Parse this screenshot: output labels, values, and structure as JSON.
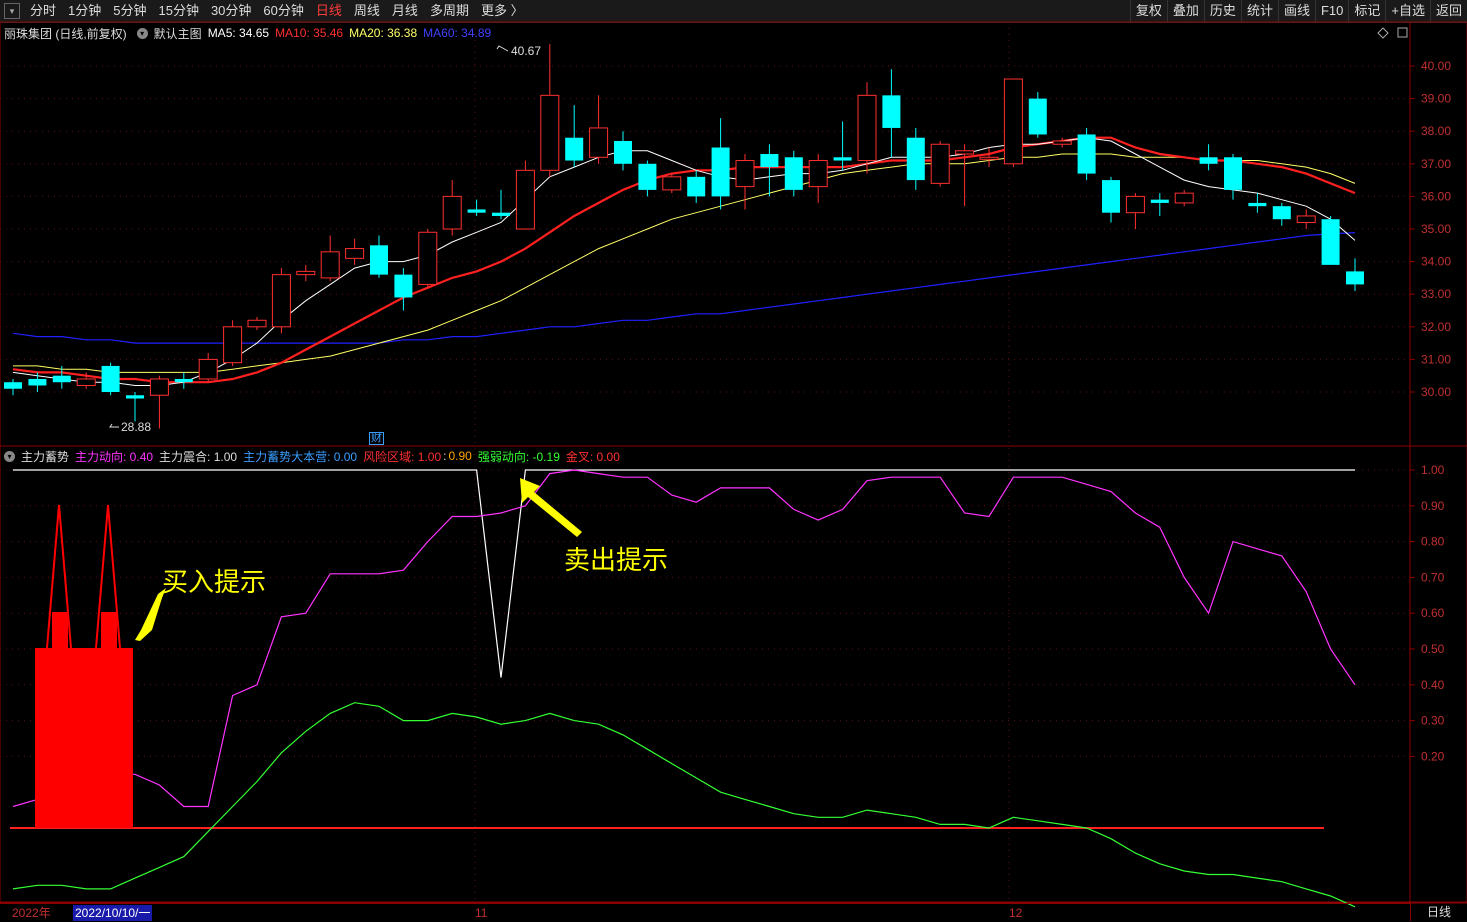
{
  "toolbar": {
    "periods": [
      "分时",
      "1分钟",
      "5分钟",
      "15分钟",
      "30分钟",
      "60分钟",
      "日线",
      "周线",
      "月线",
      "多周期",
      "更多 〉"
    ],
    "active_period": "日线",
    "right_buttons": [
      "复权",
      "叠加",
      "历史",
      "统计",
      "画线",
      "F10",
      "标记",
      "+自选",
      "返回"
    ]
  },
  "main_legend": {
    "stock": "丽珠集团 (日线,前复权)",
    "template": "默认主图",
    "ma5": "MA5: 34.65",
    "ma10": "MA10: 35.46",
    "ma20": "MA20: 36.38",
    "ma60": "MA60: 34.89"
  },
  "sub_legend": {
    "name": "主力蓄势",
    "dir": "主力动向: 0.40",
    "coin": "主力震合: 1.00",
    "big": "主力蓄势大本营: 0.00",
    "risk_label": "风险区域: 1.00",
    "risk_sep": ":",
    "risk_val": "0.90",
    "strong": "强弱动向: -0.19",
    "gold": "金叉: 0.00"
  },
  "colors": {
    "up": "#ff3030",
    "down": "#00ffff",
    "ma5": "#ffffff",
    "ma10": "#ff2020",
    "ma20": "#ffff66",
    "ma60": "#2020ff",
    "dir": "#ff33ff",
    "strong": "#33ff33",
    "annot": "#ffff00"
  },
  "price_axis": [
    "40.00",
    "39.00",
    "38.00",
    "37.00",
    "36.00",
    "35.00",
    "34.00",
    "33.00",
    "32.00",
    "31.00",
    "30.00"
  ],
  "ind_axis": [
    "1.00",
    "0.90",
    "0.80",
    "0.70",
    "0.60",
    "0.50",
    "0.40",
    "0.30",
    "0.20"
  ],
  "marks": {
    "high": "40.67",
    "low": "28.88",
    "cai": "财"
  },
  "dates": {
    "year": "2022年",
    "cursor": "2022/10/10/一",
    "m11": "11",
    "m12": "12"
  },
  "annotations": {
    "buy": "买入提示",
    "sell": "卖出提示"
  },
  "corner": "日线",
  "candles": [
    [
      30.3,
      30.1,
      30.4,
      29.9
    ],
    [
      30.4,
      30.2,
      30.6,
      30.0
    ],
    [
      30.5,
      30.3,
      30.8,
      30.1
    ],
    [
      30.2,
      30.4,
      30.6,
      30.1
    ],
    [
      30.8,
      30.0,
      30.9,
      29.9
    ],
    [
      29.9,
      29.8,
      30.0,
      29.1
    ],
    [
      29.9,
      30.4,
      30.5,
      28.88
    ],
    [
      30.4,
      30.3,
      30.6,
      30.1
    ],
    [
      30.4,
      31.0,
      31.2,
      30.3
    ],
    [
      30.9,
      32.0,
      32.2,
      30.8
    ],
    [
      32.0,
      32.2,
      32.3,
      31.9
    ],
    [
      32.0,
      33.6,
      33.8,
      31.8
    ],
    [
      33.6,
      33.7,
      33.9,
      33.4
    ],
    [
      33.5,
      34.3,
      34.8,
      33.4
    ],
    [
      34.1,
      34.4,
      34.7,
      33.9
    ],
    [
      34.5,
      33.6,
      34.8,
      33.5
    ],
    [
      33.6,
      32.9,
      33.8,
      32.5
    ],
    [
      33.3,
      34.9,
      35.0,
      33.2
    ],
    [
      35.0,
      36.0,
      36.5,
      34.8
    ],
    [
      35.6,
      35.5,
      35.9,
      35.4
    ],
    [
      35.5,
      35.4,
      36.2,
      35.3
    ],
    [
      35.0,
      36.8,
      37.1,
      35.0
    ],
    [
      36.8,
      39.1,
      40.67,
      36.6
    ],
    [
      37.8,
      37.1,
      38.8,
      36.9
    ],
    [
      37.2,
      38.1,
      39.1,
      37.0
    ],
    [
      37.7,
      37.0,
      38.0,
      36.8
    ],
    [
      37.0,
      36.2,
      37.1,
      36.0
    ],
    [
      36.2,
      36.6,
      36.7,
      36.1
    ],
    [
      36.6,
      36.0,
      36.8,
      35.8
    ],
    [
      37.5,
      36.0,
      38.4,
      35.6
    ],
    [
      36.3,
      37.1,
      37.3,
      35.6
    ],
    [
      37.3,
      36.9,
      37.6,
      36.0
    ],
    [
      37.2,
      36.2,
      37.4,
      36.0
    ],
    [
      36.3,
      37.1,
      37.3,
      35.8
    ],
    [
      37.2,
      37.1,
      38.3,
      36.8
    ],
    [
      37.1,
      39.1,
      39.5,
      36.7
    ],
    [
      39.1,
      38.1,
      39.9,
      37.2
    ],
    [
      37.8,
      36.5,
      38.1,
      36.2
    ],
    [
      36.4,
      37.6,
      37.7,
      36.3
    ],
    [
      37.3,
      37.4,
      37.6,
      35.7
    ],
    [
      37.2,
      37.2,
      37.5,
      36.9
    ],
    [
      37.0,
      39.6,
      39.6,
      36.9
    ],
    [
      39.0,
      37.9,
      39.2,
      37.8
    ],
    [
      37.6,
      37.7,
      37.8,
      37.5
    ],
    [
      37.9,
      36.7,
      38.1,
      36.5
    ],
    [
      36.5,
      35.5,
      36.6,
      35.2
    ],
    [
      35.5,
      36.0,
      36.1,
      35.0
    ],
    [
      35.9,
      35.8,
      36.1,
      35.4
    ],
    [
      35.8,
      36.1,
      36.2,
      35.7
    ],
    [
      37.2,
      37.0,
      37.6,
      36.8
    ],
    [
      37.2,
      36.2,
      37.3,
      35.9
    ],
    [
      35.8,
      35.7,
      36.1,
      35.5
    ],
    [
      35.7,
      35.3,
      35.8,
      35.1
    ],
    [
      35.2,
      35.4,
      35.6,
      35.0
    ],
    [
      35.3,
      33.9,
      35.4,
      33.9
    ],
    [
      33.7,
      33.3,
      34.1,
      33.1
    ]
  ],
  "ma5": [
    30.6,
    30.5,
    30.4,
    30.3,
    30.3,
    30.2,
    30.2,
    30.3,
    30.6,
    31.0,
    31.5,
    32.2,
    32.8,
    33.3,
    33.8,
    34.0,
    34.0,
    34.2,
    34.6,
    34.9,
    35.2,
    35.9,
    36.6,
    36.9,
    37.2,
    37.4,
    37.4,
    37.1,
    36.8,
    36.6,
    36.5,
    36.6,
    36.7,
    36.7,
    36.8,
    37.0,
    37.2,
    37.2,
    37.2,
    37.3,
    37.5,
    37.6,
    37.6,
    37.7,
    37.8,
    37.7,
    37.3,
    36.9,
    36.5,
    36.3,
    36.2,
    36.1,
    35.9,
    35.7,
    35.3,
    34.65
  ],
  "ma10": [
    30.7,
    30.6,
    30.6,
    30.5,
    30.4,
    30.4,
    30.3,
    30.3,
    30.3,
    30.4,
    30.6,
    30.9,
    31.3,
    31.7,
    32.1,
    32.5,
    32.9,
    33.2,
    33.5,
    33.7,
    34.0,
    34.4,
    34.9,
    35.4,
    35.8,
    36.2,
    36.5,
    36.7,
    36.8,
    36.8,
    36.9,
    36.9,
    36.9,
    36.9,
    36.9,
    37.0,
    37.1,
    37.1,
    37.1,
    37.2,
    37.3,
    37.5,
    37.6,
    37.7,
    37.8,
    37.8,
    37.5,
    37.3,
    37.2,
    37.1,
    37.1,
    37.0,
    36.9,
    36.7,
    36.4,
    36.1
  ],
  "ma20": [
    30.8,
    30.8,
    30.7,
    30.7,
    30.6,
    30.6,
    30.6,
    30.6,
    30.6,
    30.7,
    30.8,
    30.9,
    31.0,
    31.1,
    31.3,
    31.5,
    31.7,
    31.9,
    32.2,
    32.5,
    32.8,
    33.2,
    33.6,
    34.0,
    34.4,
    34.7,
    35.0,
    35.3,
    35.5,
    35.7,
    35.9,
    36.1,
    36.3,
    36.5,
    36.7,
    36.8,
    36.9,
    37.0,
    37.0,
    37.0,
    37.1,
    37.2,
    37.2,
    37.3,
    37.3,
    37.3,
    37.2,
    37.2,
    37.2,
    37.1,
    37.1,
    37.1,
    37.0,
    36.9,
    36.7,
    36.4
  ],
  "ma60": [
    31.8,
    31.7,
    31.7,
    31.6,
    31.6,
    31.5,
    31.5,
    31.5,
    31.5,
    31.5,
    31.5,
    31.5,
    31.5,
    31.5,
    31.5,
    31.5,
    31.6,
    31.6,
    31.7,
    31.7,
    31.8,
    31.9,
    32.0,
    32.0,
    32.1,
    32.2,
    32.2,
    32.3,
    32.4,
    32.4,
    32.5,
    32.6,
    32.7,
    32.8,
    32.9,
    33.0,
    33.1,
    33.2,
    33.3,
    33.4,
    33.5,
    33.6,
    33.7,
    33.8,
    33.9,
    34.0,
    34.1,
    34.2,
    34.3,
    34.4,
    34.5,
    34.6,
    34.7,
    34.8,
    34.85,
    34.89
  ],
  "dir": [
    0.06,
    0.08,
    0.1,
    0.1,
    0.15,
    0.15,
    0.12,
    0.06,
    0.06,
    0.37,
    0.4,
    0.59,
    0.6,
    0.71,
    0.71,
    0.71,
    0.72,
    0.8,
    0.87,
    0.87,
    0.88,
    0.9,
    0.99,
    1.0,
    0.99,
    0.98,
    0.98,
    0.93,
    0.91,
    0.95,
    0.95,
    0.95,
    0.89,
    0.86,
    0.89,
    0.97,
    0.98,
    0.98,
    0.98,
    0.88,
    0.87,
    0.98,
    0.98,
    0.98,
    0.96,
    0.94,
    0.88,
    0.84,
    0.7,
    0.6,
    0.8,
    0.78,
    0.76,
    0.66,
    0.5,
    0.4
  ],
  "strong": [
    -0.17,
    -0.16,
    -0.16,
    -0.17,
    -0.17,
    -0.14,
    -0.11,
    -0.08,
    -0.01,
    0.06,
    0.13,
    0.21,
    0.27,
    0.32,
    0.35,
    0.34,
    0.3,
    0.3,
    0.32,
    0.31,
    0.29,
    0.3,
    0.32,
    0.3,
    0.29,
    0.26,
    0.22,
    0.18,
    0.14,
    0.1,
    0.08,
    0.06,
    0.04,
    0.03,
    0.03,
    0.05,
    0.04,
    0.03,
    0.01,
    0.01,
    0.0,
    0.03,
    0.02,
    0.01,
    0.0,
    -0.03,
    -0.07,
    -0.1,
    -0.12,
    -0.13,
    -0.13,
    -0.14,
    -0.15,
    -0.17,
    -0.19,
    -0.22
  ],
  "risk": [
    1.0,
    1.0,
    1.0,
    1.0,
    1.0,
    1.0,
    1.0,
    1.0,
    1.0,
    1.0,
    1.0,
    1.0,
    1.0,
    1.0,
    1.0,
    1.0,
    1.0,
    1.0,
    1.0,
    1.0,
    0.42,
    1.0,
    1.0,
    1.0,
    1.0,
    1.0,
    1.0,
    1.0,
    1.0,
    1.0,
    1.0,
    1.0,
    1.0,
    1.0,
    1.0,
    1.0,
    1.0,
    1.0,
    1.0,
    1.0,
    1.0,
    1.0,
    1.0,
    1.0,
    1.0,
    1.0,
    1.0,
    1.0,
    1.0,
    1.0,
    1.0,
    1.0,
    1.0,
    1.0,
    1.0,
    1.0
  ]
}
